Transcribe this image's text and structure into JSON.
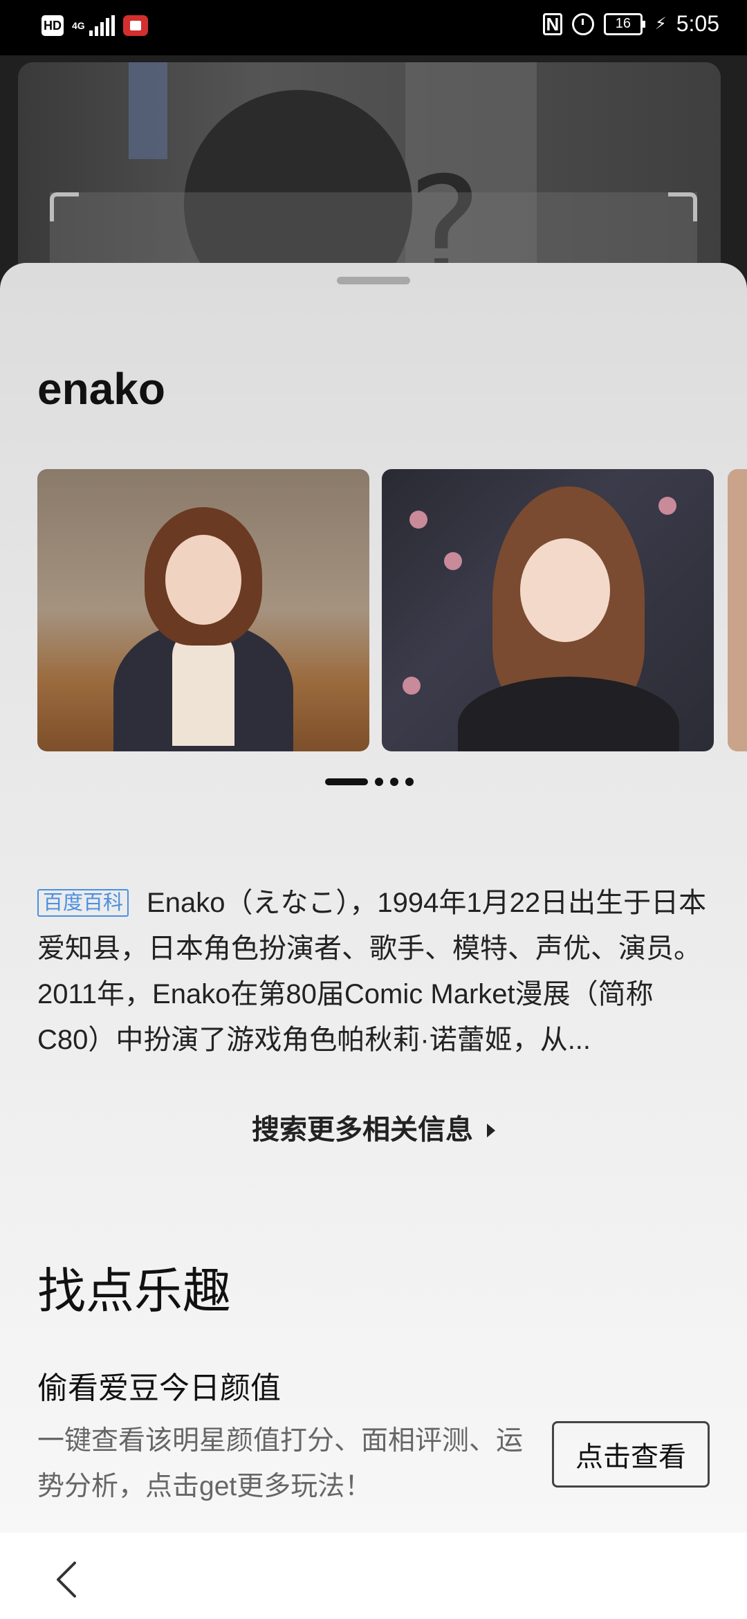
{
  "status_bar": {
    "hd": "HD",
    "network": "4G",
    "battery": "16",
    "time": "5:05",
    "icons": [
      "hd-icon",
      "signal-icon",
      "screen-record-icon",
      "nfc-icon",
      "alarm-icon",
      "battery-icon",
      "charging-icon"
    ]
  },
  "result": {
    "name": "enako",
    "carousel": {
      "images": [
        "photo-1",
        "photo-2",
        "photo-3"
      ],
      "active_index": 0
    },
    "summary": {
      "source": "百度百科",
      "text": "Enako（えなこ），1994年1月22日出生于日本爱知县，日本角色扮演者、歌手、模特、声优、演员。2011年，Enako在第80届Comic Market漫展（简称C80）中扮演了游戏角色帕秋莉·诺蕾姬，从..."
    },
    "more_link": "搜索更多相关信息"
  },
  "fun": {
    "section_title": "找点乐趣",
    "card_title": "偷看爱豆今日颜值",
    "card_desc": "一键查看该明星颜值打分、面相评测、运势分析，点击get更多玩法！",
    "button": "点击查看"
  },
  "nav": {
    "back_icon": "back-icon"
  }
}
